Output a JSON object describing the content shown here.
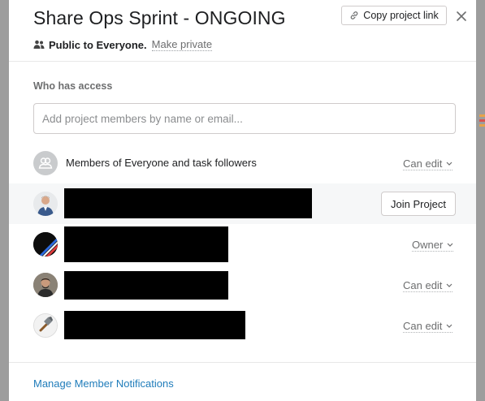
{
  "modal": {
    "title": "Share Ops Sprint - ONGOING",
    "visibility_label": "Public to Everyone.",
    "make_private_label": "Make private",
    "copy_link_label": "Copy project link"
  },
  "access": {
    "section_label": "Who has access",
    "input_placeholder": "Add project members by name or email...",
    "group_label": "Members of Everyone and task followers",
    "group_permission": "Can edit",
    "members": [
      {
        "action": "Join Project",
        "avatar_icon": "user-photo-avatar",
        "name_redacted": true
      },
      {
        "permission": "Owner",
        "avatar_icon": "stripes-avatar",
        "name_redacted": true
      },
      {
        "permission": "Can edit",
        "avatar_icon": "user-photo-avatar",
        "name_redacted": true
      },
      {
        "permission": "Can edit",
        "avatar_icon": "hammer-avatar",
        "name_redacted": true
      }
    ]
  },
  "footer": {
    "manage_notifications_label": "Manage Member Notifications"
  },
  "colors": {
    "link": "#1f7cba",
    "muted_text": "#6d6e6f",
    "primary_text": "#1e1f21",
    "highlight_row": "#f6f7f8"
  }
}
